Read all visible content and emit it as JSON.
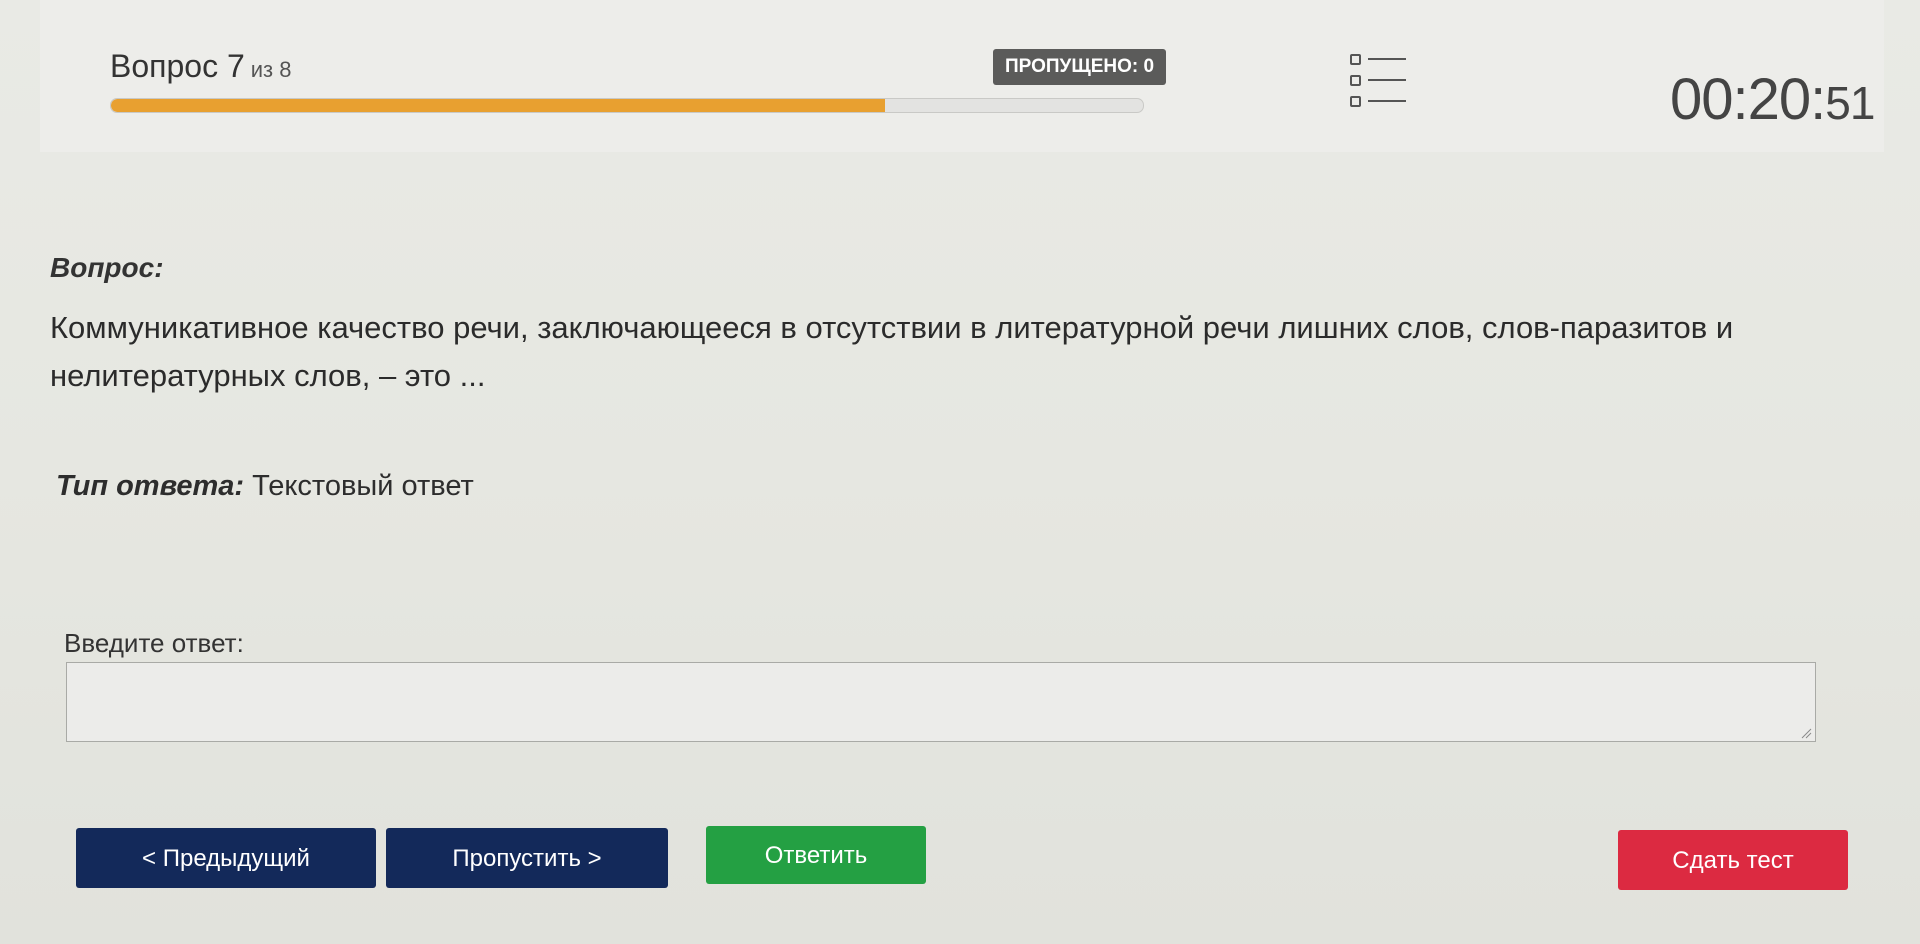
{
  "header": {
    "question_label": "Вопрос 7",
    "question_of": "из 8",
    "progress_fraction": 0.75,
    "skipped_badge": "ПРОПУЩЕНО: 0",
    "timer_main": "00:20:",
    "timer_seconds": "51"
  },
  "question": {
    "heading": "Вопрос:",
    "text": "Коммуникативное качество речи, заключающееся в отсутствии в литературной речи лишних слов, слов-паразитов и нелитературных слов, – это ..."
  },
  "answer_type": {
    "label": "Тип ответа:",
    "value": "Текстовый ответ"
  },
  "answer_input": {
    "label": "Введите ответ:",
    "value": ""
  },
  "buttons": {
    "prev": "< Предыдущий",
    "skip": "Пропустить >",
    "answer": "Ответить",
    "finish": "Сдать тест"
  },
  "colors": {
    "progress": "#e8a030",
    "nav_button": "#13295a",
    "answer_button": "#24a043",
    "finish_button": "#dc2a41",
    "badge": "#5b5b5a"
  },
  "icons": {
    "question_list": "list-icon"
  }
}
